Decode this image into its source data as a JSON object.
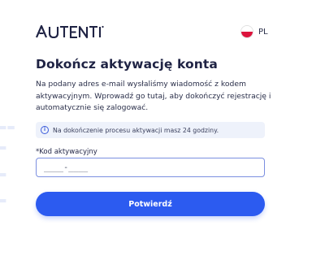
{
  "brand": {
    "logo_text": "AUTENTI",
    "primary_color": "#2c5bf0",
    "text_color": "#1f2344"
  },
  "language": {
    "code": "PL",
    "flag_icon": "poland-flag-icon"
  },
  "page": {
    "title": "Dokończ aktywację konta",
    "description": "Na podany adres e-mail wysłaliśmy wiadomość z kodem aktywacyjnym. Wprowadź go tutaj, aby dokończyć rejestrację i automatycznie się zalogować.",
    "info": "Na dokończenie procesu aktywacji masz 24 godziny."
  },
  "form": {
    "code_label_required": "*",
    "code_label": "Kod aktywacyjny",
    "code_placeholder": "____-____",
    "submit_label": "Potwierdź"
  }
}
